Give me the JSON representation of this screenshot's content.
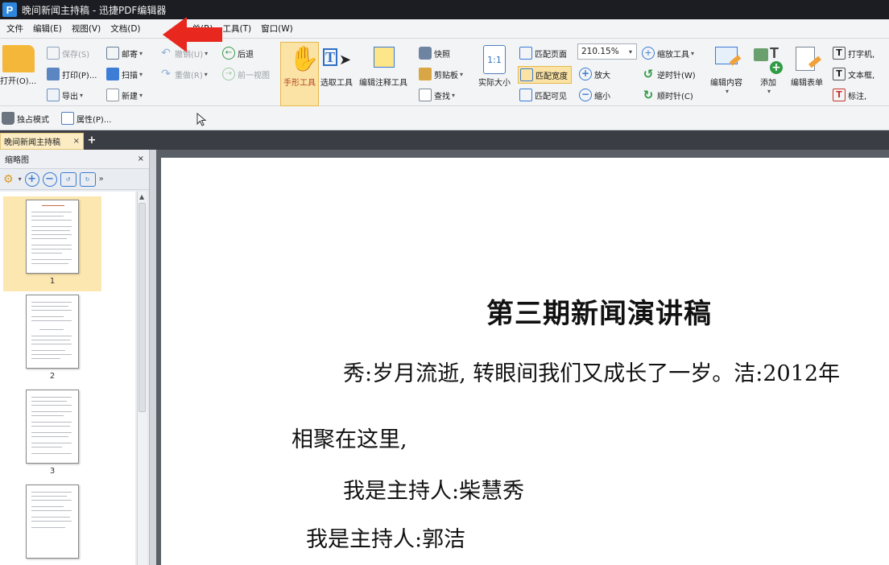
{
  "window": {
    "title": "晚间新闻主持稿 - 迅捷PDF编辑器",
    "app_icon_letter": "P"
  },
  "menu": [
    "文件",
    "编辑(E)",
    "视图(V)",
    "文档(D)",
    "单(R)",
    "工具(T)",
    "窗口(W)"
  ],
  "ribbon": {
    "open": "打开(O)...",
    "save": "保存(S)",
    "print": "打印(P)...",
    "export": "导出",
    "mail": "邮寄",
    "scan": "扫描",
    "new": "新建",
    "undo": "撤销(U)",
    "redo": "重做(R)",
    "back": "后退",
    "prev_view": "前一视图",
    "hand_tool": "手形工具",
    "select_tool": "选取工具",
    "edit_annot": "编辑注释工具",
    "snapshot": "快照",
    "clipboard": "剪贴板",
    "find": "查找",
    "actual_size": "实际大小",
    "actual_size_icon_text": "1:1",
    "fit_page": "匹配页面",
    "fit_width": "匹配宽度",
    "fit_visible": "匹配可见",
    "zoom_value": "210.15%",
    "zoom_in": "放大",
    "zoom_out": "缩小",
    "zoom_tool": "缩放工具",
    "rotate_ccw": "逆时针(W)",
    "rotate_cw": "顺时针(C)",
    "edit_content": "编辑内容",
    "add": "添加",
    "edit_form": "编辑表单",
    "typewriter": "打字机,",
    "textbox": "文本框,",
    "callout": "标注,"
  },
  "quickbar": {
    "exclusive_mode": "独占模式",
    "properties": "属性(P)..."
  },
  "tabs": {
    "doc_tab": "晚间新闻主持稿",
    "close": "×",
    "add": "+"
  },
  "thumbnail_panel": {
    "title": "缩略图",
    "close": "×",
    "pages": [
      "1",
      "2",
      "3"
    ]
  },
  "document": {
    "title": "第三期新闻演讲稿",
    "para1": "秀:岁月流逝, 转眼间我们又成长了一岁。洁:2012年",
    "para2": "相聚在这里,",
    "para3": "我是主持人:柴慧秀",
    "para4": "我是主持人:郭洁"
  },
  "colors": {
    "titlebar": "#1b1d22",
    "ribbon_bg": "#f3f4f6",
    "selected_tool": "#fbe3a6",
    "annotation_arrow": "#e8281e",
    "accent_blue": "#3b7bd3"
  }
}
